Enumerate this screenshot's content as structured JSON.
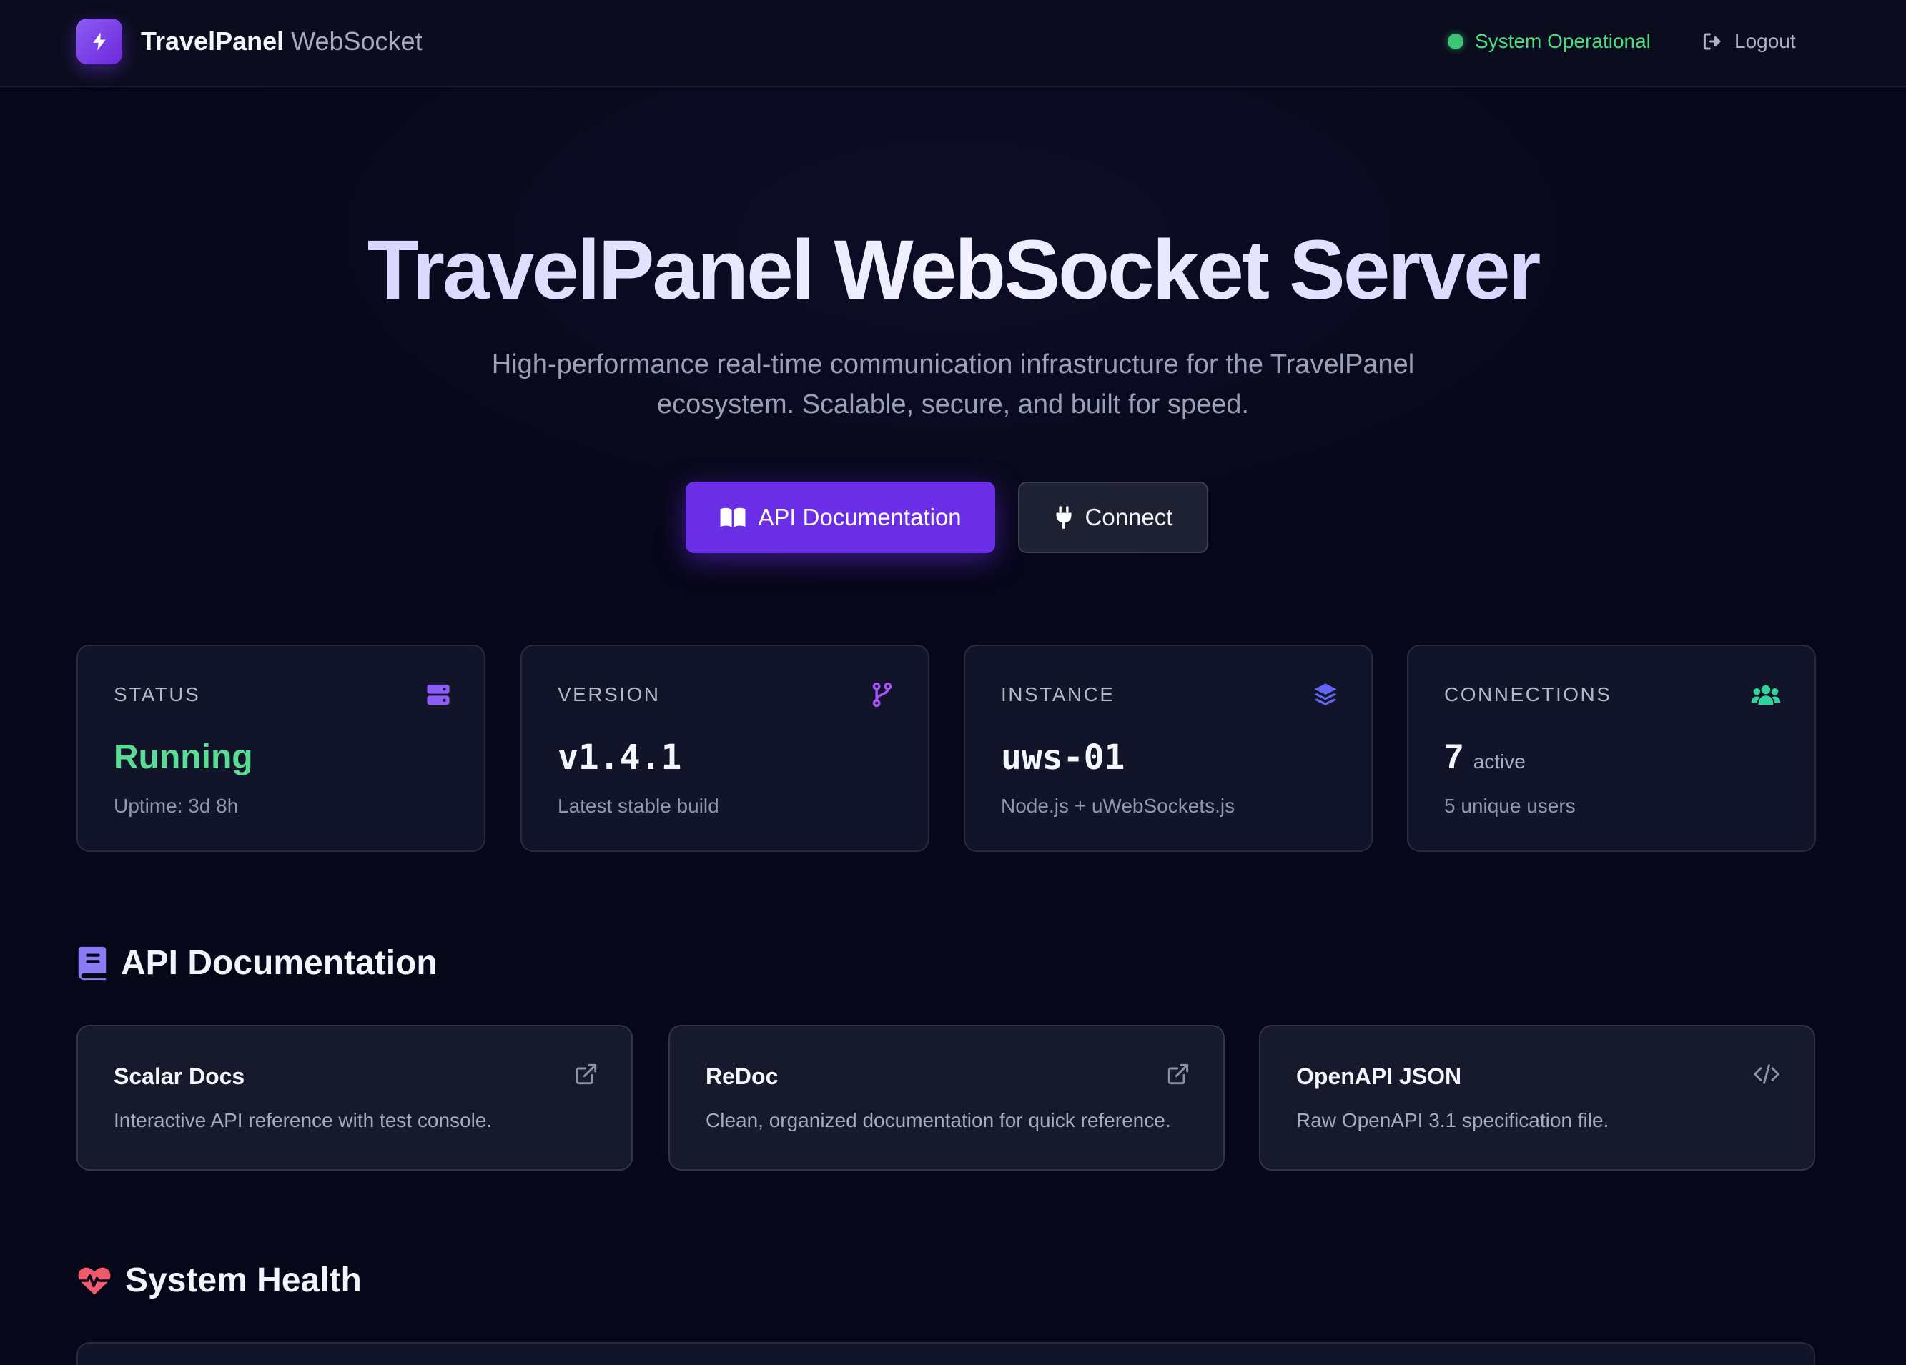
{
  "header": {
    "brand_main": "TravelPanel",
    "brand_sub": "WebSocket",
    "status_text": "System Operational",
    "logout_label": "Logout"
  },
  "hero": {
    "title": "TravelPanel WebSocket Server",
    "subtitle": "High-performance real-time communication infrastructure for the TravelPanel ecosystem. Scalable, secure, and built for speed.",
    "primary_button": "API Documentation",
    "secondary_button": "Connect"
  },
  "stats": [
    {
      "label": "STATUS",
      "value": "Running",
      "sub": "Uptime: 3d 8h",
      "icon": "server-icon",
      "icon_color": "#8b5cf6"
    },
    {
      "label": "VERSION",
      "value": "v1.4.1",
      "sub": "Latest stable build",
      "icon": "git-branch-icon",
      "icon_color": "#a855f7"
    },
    {
      "label": "INSTANCE",
      "value": "uws-01",
      "sub": "Node.js + uWebSockets.js",
      "icon": "layers-icon",
      "icon_color": "#6366f1"
    },
    {
      "label": "CONNECTIONS",
      "value": "7",
      "value_suffix": "active",
      "sub": "5 unique users",
      "icon": "users-icon",
      "icon_color": "#34d399"
    }
  ],
  "sections": {
    "docs_title": "API Documentation",
    "health_title": "System Health"
  },
  "docs": [
    {
      "title": "Scalar Docs",
      "desc": "Interactive API reference with test console.",
      "icon": "external-link-icon"
    },
    {
      "title": "ReDoc",
      "desc": "Clean, organized documentation for quick reference.",
      "icon": "external-link-icon"
    },
    {
      "title": "OpenAPI JSON",
      "desc": "Raw OpenAPI 3.1 specification file.",
      "icon": "code-icon"
    }
  ],
  "colors": {
    "accent": "#6a2ee6",
    "status_green": "#3bc574",
    "health_icon": "#f05a6e",
    "docs_icon": "#8b7cf6"
  }
}
